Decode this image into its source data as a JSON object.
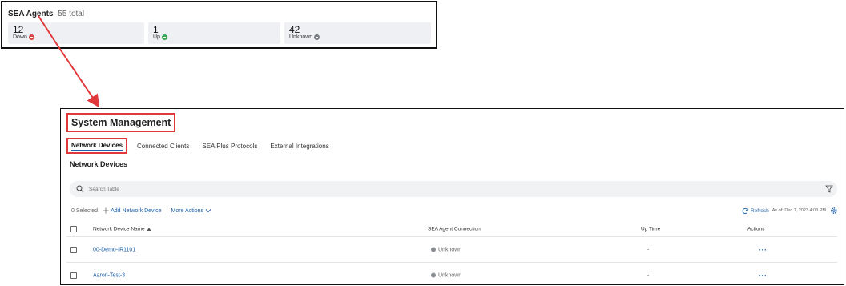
{
  "summary": {
    "title": "SEA Agents",
    "total": "55 total",
    "stats": [
      {
        "value": "12",
        "label": "Down",
        "status": "down",
        "color": "#d94848"
      },
      {
        "value": "1",
        "label": "Up",
        "status": "up",
        "color": "#3aa556"
      },
      {
        "value": "42",
        "label": "Unknown",
        "status": "unknown",
        "color": "#7c7f86"
      }
    ]
  },
  "main": {
    "title": "System Management",
    "tabs": [
      {
        "label": "Network Devices",
        "active": true
      },
      {
        "label": "Connected Clients",
        "active": false
      },
      {
        "label": "SEA Plus Protocols",
        "active": false
      },
      {
        "label": "External Integrations",
        "active": false
      }
    ],
    "section_title": "Network Devices",
    "search": {
      "placeholder": "Search Table"
    },
    "toolbar": {
      "selected": "0 Selected",
      "add_label": "Add Network Device",
      "more_label": "More Actions",
      "refresh_label": "Refresh",
      "as_of": "As of: Dec 1, 2023 4:03 PM"
    },
    "table": {
      "columns": {
        "name": "Network Device Name",
        "connection": "SEA Agent Connection",
        "uptime": "Up Time",
        "actions": "Actions"
      },
      "rows": [
        {
          "name": "00-Demo-IR1101",
          "connection": "Unknown",
          "uptime": "-",
          "actions": "···"
        },
        {
          "name": "Aaron-Test-3",
          "connection": "Unknown",
          "uptime": "-",
          "actions": "···"
        }
      ]
    }
  },
  "colors": {
    "accent": "#1d5fa8",
    "highlight": "#e0393c",
    "down": "#d94848",
    "up": "#3aa556",
    "unknown": "#7c7f86"
  }
}
